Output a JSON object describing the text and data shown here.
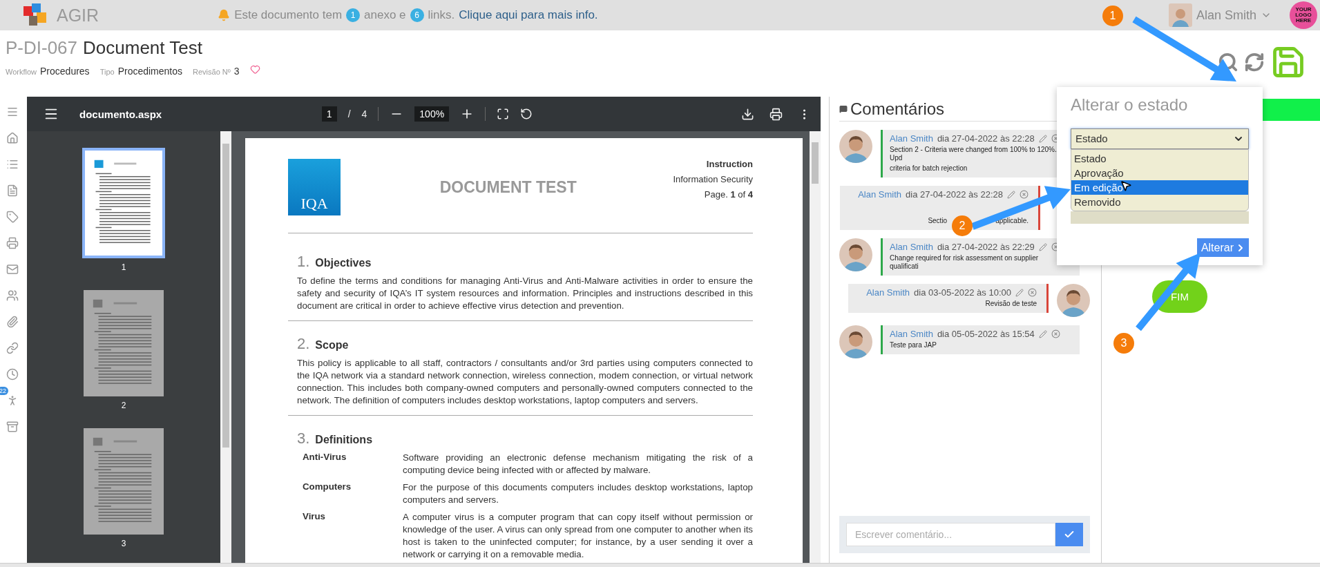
{
  "topbar": {
    "app_name": "AGIR",
    "notice": {
      "before": "Este documento tem",
      "attachments": "1",
      "middle": "anexo e",
      "links": "6",
      "after": "links.",
      "link": "Clique aqui para mais info."
    },
    "user": {
      "name": "Alan Smith"
    },
    "logo_text": "YOUR LOGO HERE"
  },
  "header": {
    "code": "P-DI-067",
    "title": "Document Test",
    "favorite": false,
    "meta": [
      {
        "label": "Workflow",
        "value": "Procedures"
      },
      {
        "label": "Tipo",
        "value": "Procedimentos"
      },
      {
        "label": "Revisão Nº",
        "value": "3"
      }
    ]
  },
  "rail": [
    {
      "kind": "menu"
    },
    {
      "kind": "home"
    },
    {
      "kind": "list"
    },
    {
      "kind": "document"
    },
    {
      "kind": "tag"
    },
    {
      "kind": "print"
    },
    {
      "kind": "mail"
    },
    {
      "kind": "contacts"
    },
    {
      "kind": "attachment"
    },
    {
      "kind": "link"
    },
    {
      "kind": "history"
    },
    {
      "kind": "accessibility",
      "badge": "22"
    },
    {
      "kind": "archive"
    }
  ],
  "pdf": {
    "filename": "documento.aspx",
    "page_current": "1",
    "page_separator": "/",
    "page_count": "4",
    "zoom": "100%",
    "thumbnails": [
      {
        "label": "1",
        "selected": true
      },
      {
        "label": "2",
        "selected": false
      },
      {
        "label": "3",
        "selected": false
      }
    ]
  },
  "document": {
    "logo": "IQA",
    "title": "DOCUMENT TEST",
    "type": "Instruction",
    "area": "Information Security",
    "page": "Page. **1** of **4**",
    "sections": [
      {
        "number": "1.",
        "title": "Objectives",
        "body": "To define the terms and conditions for managing Anti-Virus and Anti-Malware activities in order to ensure the safety and security of IQA’s IT system resources and information. Principles and instructions described in this document are critical in order to achieve effective virus detection and prevention."
      },
      {
        "number": "2.",
        "title": "Scope",
        "body": "This policy is applicable to all staff, contractors / consultants and/or 3rd parties using computers connected to the IQA network via a standard network connection, wireless connection, modem connection, or virtual network connection. This includes both company-owned computers and personally-owned computers connected to the network. The definition of computers includes desktop workstations, laptop computers and servers."
      },
      {
        "number": "3.",
        "title": "Definitions",
        "definitions": [
          {
            "term": "Anti-Virus",
            "text": "Software providing an electronic defense mechanism mitigating the risk of a computing device being infected with or affected by malware."
          },
          {
            "term": "Computers",
            "text": "For the purpose of this documents computers includes desktop workstations, laptop computers and servers."
          },
          {
            "term": "Virus",
            "text": "A computer virus is a computer program that can copy itself without permission or knowledge of the user. A virus can only spread from one computer to another when its host is taken to the uninfected computer; for instance, by a user sending it over a network or carrying it on a removable media."
          }
        ]
      }
    ]
  },
  "comments": {
    "title": "Comentários",
    "placeholder": "Escrever comentário...",
    "items": [
      {
        "kind": "left",
        "color": "#2ea84a",
        "avatar": true,
        "author": "Alan Smith",
        "date": "dia 27-04-2022 às 22:28",
        "lines": [
          "Section 2 - Criteria were changed from 100% to 120%. Upd",
          "criteria for batch rejection"
        ]
      },
      {
        "kind": "right",
        "color": "#d9463a",
        "avatar": false,
        "author": "Alan Smith",
        "date": "dia 27-04-2022 às 22:28",
        "fragments": [
          "Sectio",
          "applicable."
        ]
      },
      {
        "kind": "left",
        "color": "#2ea84a",
        "avatar": true,
        "author": "Alan Smith",
        "date": "dia 27-04-2022 às 22:29",
        "lines": [
          "Change required for risk assessment on supplier qualificati"
        ]
      },
      {
        "kind": "right",
        "color": "#d9463a",
        "avatar": true,
        "author": "Alan Smith",
        "date": "dia 03-05-2022 às 10:00",
        "lines": [
          "Revisão de teste"
        ]
      },
      {
        "kind": "left",
        "color": "#2ea84a",
        "avatar": true,
        "author": "Alan Smith",
        "date": "dia 05-05-2022 às 15:54",
        "lines": [
          "Teste para JAP"
        ]
      }
    ]
  },
  "state_popover": {
    "title": "Alterar o estado",
    "value": "Estado",
    "options": [
      {
        "label": "Estado",
        "highlighted": false
      },
      {
        "label": "Aprovação",
        "highlighted": false
      },
      {
        "label": "Em edição",
        "highlighted": true
      },
      {
        "label": "Removido",
        "highlighted": false
      }
    ],
    "button": "Alterar"
  },
  "flow": {
    "end_node": "FIM"
  },
  "annotations": [
    {
      "label": "1"
    },
    {
      "label": "2"
    },
    {
      "label": "3"
    }
  ]
}
